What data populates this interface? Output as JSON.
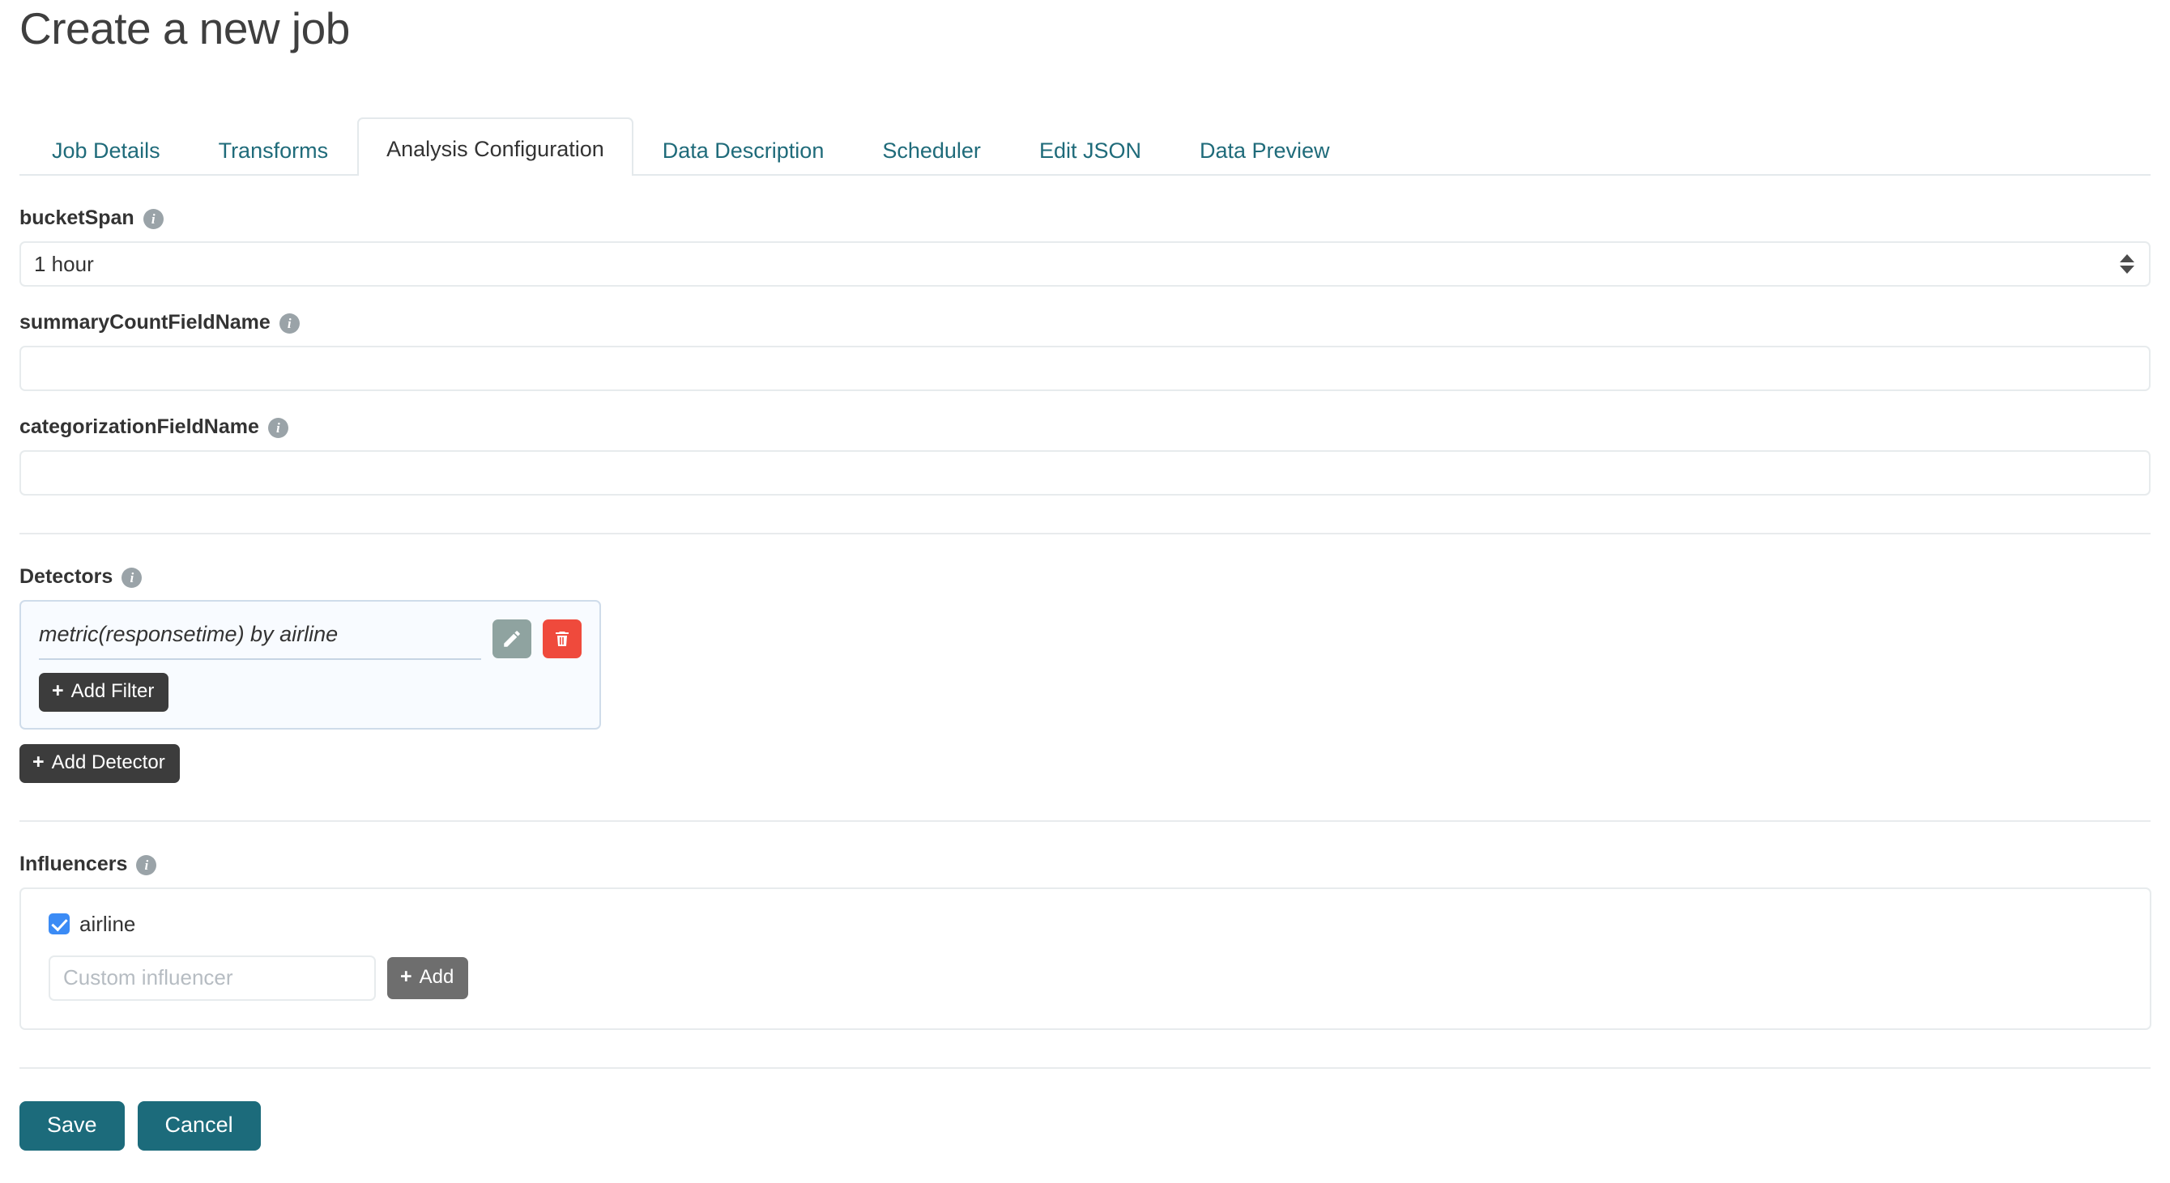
{
  "page": {
    "title": "Create a new job"
  },
  "tabs": [
    {
      "label": "Job Details",
      "active": false
    },
    {
      "label": "Transforms",
      "active": false
    },
    {
      "label": "Analysis Configuration",
      "active": true
    },
    {
      "label": "Data Description",
      "active": false
    },
    {
      "label": "Scheduler",
      "active": false
    },
    {
      "label": "Edit JSON",
      "active": false
    },
    {
      "label": "Data Preview",
      "active": false
    }
  ],
  "fields": {
    "bucket_span": {
      "label": "bucketSpan",
      "info_icon": "info-icon",
      "value": "1 hour",
      "options": [
        "1 hour"
      ]
    },
    "summary_count_field_name": {
      "label": "summaryCountFieldName",
      "info_icon": "info-icon",
      "value": "",
      "placeholder": ""
    },
    "categorization_field_name": {
      "label": "categorizationFieldName",
      "info_icon": "info-icon",
      "value": "",
      "placeholder": ""
    }
  },
  "detectors": {
    "label": "Detectors",
    "info_icon": "info-icon",
    "items": [
      {
        "name": "metric(responsetime) by airline",
        "edit_icon": "pencil-icon",
        "delete_icon": "trash-icon",
        "add_filter_label": "Add Filter",
        "add_filter_icon": "plus-icon"
      }
    ],
    "add_detector_label": "Add Detector",
    "add_detector_icon": "plus-icon"
  },
  "influencers": {
    "label": "Influencers",
    "info_icon": "info-icon",
    "checkboxes": [
      {
        "label": "airline",
        "checked": true
      }
    ],
    "custom_placeholder": "Custom influencer",
    "custom_value": "",
    "add_label": "Add",
    "add_icon": "plus-icon"
  },
  "footer": {
    "save_label": "Save",
    "cancel_label": "Cancel"
  },
  "colors": {
    "accent_teal": "#1c6b7b",
    "tab_link": "#1f6b7a",
    "danger_red": "#ef4a3c",
    "edit_gray": "#8fa3a0",
    "dark_button": "#3c3c3c",
    "gray_button": "#6e6e6e",
    "checkbox_blue": "#3b8bf5",
    "card_border_blue": "#cfdcea",
    "card_bg_blue": "#f8fbff",
    "input_border": "#e7ebed"
  }
}
